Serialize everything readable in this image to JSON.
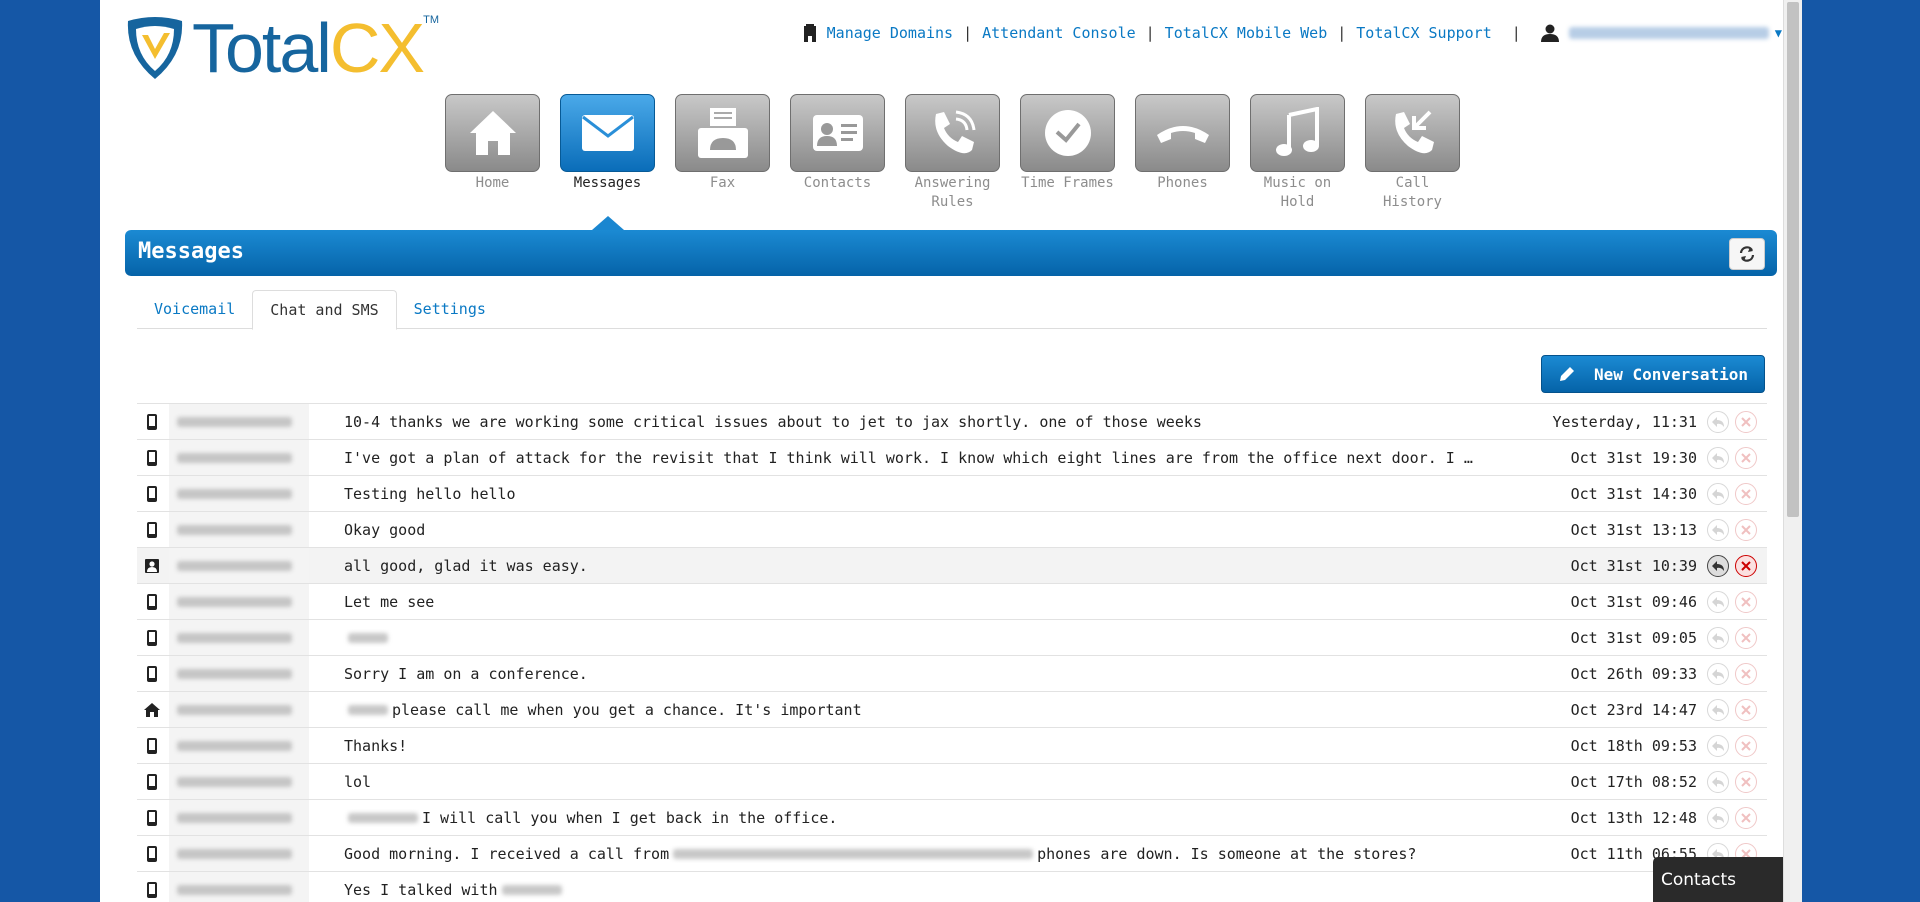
{
  "logo": {
    "total": "Total",
    "cx": "CX",
    "tm": "TM"
  },
  "toplinks": [
    {
      "label": "Manage Domains"
    },
    {
      "label": "Attendant Console"
    },
    {
      "label": "TotalCX Mobile Web"
    },
    {
      "label": "TotalCX Support"
    }
  ],
  "nav": [
    {
      "label": "Home",
      "icon": "home-icon",
      "active": false
    },
    {
      "label": "Messages",
      "icon": "envelope-icon",
      "active": true
    },
    {
      "label": "Fax",
      "icon": "fax-icon",
      "active": false
    },
    {
      "label": "Contacts",
      "icon": "contact-card-icon",
      "active": false
    },
    {
      "label": "Answering Rules",
      "icon": "phone-waves-icon",
      "active": false
    },
    {
      "label": "Time Frames",
      "icon": "clock-icon",
      "active": false
    },
    {
      "label": "Phones",
      "icon": "handset-icon",
      "active": false
    },
    {
      "label": "Music on Hold",
      "icon": "music-note-icon",
      "active": false
    },
    {
      "label": "Call History",
      "icon": "phone-arrow-icon",
      "active": false
    }
  ],
  "page_title": "Messages",
  "tabs": [
    {
      "label": "Voicemail",
      "active": false
    },
    {
      "label": "Chat and SMS",
      "active": true
    },
    {
      "label": "Settings",
      "active": false
    }
  ],
  "new_conversation_label": "New Conversation",
  "messages": [
    {
      "icon": "mobile",
      "pre": "",
      "text": "10-4 thanks we are working some critical issues about to jet to jax shortly. one of those weeks",
      "post": "",
      "time": "Yesterday, 11:31"
    },
    {
      "icon": "mobile",
      "pre": "",
      "text": "I've got a plan of attack for the revisit that I think will work. I know which eight lines are from the office next door. I …",
      "post": "",
      "time": "Oct 31st 19:30"
    },
    {
      "icon": "mobile",
      "pre": "",
      "text": "Testing hello hello",
      "post": "",
      "time": "Oct 31st 14:30"
    },
    {
      "icon": "mobile",
      "pre": "",
      "text": "Okay good",
      "post": "",
      "time": "Oct 31st 13:13"
    },
    {
      "icon": "contact",
      "pre": "",
      "text": "all good, glad it was easy.",
      "post": "",
      "time": "Oct 31st 10:39",
      "highlight": true
    },
    {
      "icon": "mobile",
      "pre": "",
      "text": "Let me see",
      "post": "",
      "time": "Oct 31st 09:46"
    },
    {
      "icon": "mobile",
      "pre": "blur",
      "text": "",
      "post": "",
      "time": "Oct 31st 09:05"
    },
    {
      "icon": "mobile",
      "pre": "",
      "text": "Sorry I am on a conference.",
      "post": "",
      "time": "Oct 26th 09:33"
    },
    {
      "icon": "home",
      "pre": "blur",
      "text": "please call me when you get a chance. It's important",
      "post": "",
      "time": "Oct 23rd 14:47"
    },
    {
      "icon": "mobile",
      "pre": "",
      "text": "Thanks!",
      "post": "",
      "time": "Oct 18th 09:53"
    },
    {
      "icon": "mobile",
      "pre": "",
      "text": "lol",
      "post": "",
      "time": "Oct 17th 08:52"
    },
    {
      "icon": "mobile",
      "pre": "blur",
      "text": "I will call you when I get back in the office.",
      "post": "",
      "time": "Oct 13th 12:48"
    },
    {
      "icon": "mobile",
      "pre": "",
      "text": "Good morning. I received a call from",
      "midblur": true,
      "post": "phones are down. Is someone at the stores?",
      "time": "Oct 11th 06:55"
    },
    {
      "icon": "mobile",
      "pre": "",
      "text": "Yes I talked with",
      "post": "",
      "postblur": true,
      "time": ""
    }
  ],
  "contacts_panel": {
    "title": "Contacts"
  },
  "colors": {
    "brand_blue": "#0a79c4",
    "bar_blue": "#0563a8",
    "logo_yellow": "#f4be2f",
    "logo_blue": "#16659e",
    "page_bg": "#1557a6"
  }
}
